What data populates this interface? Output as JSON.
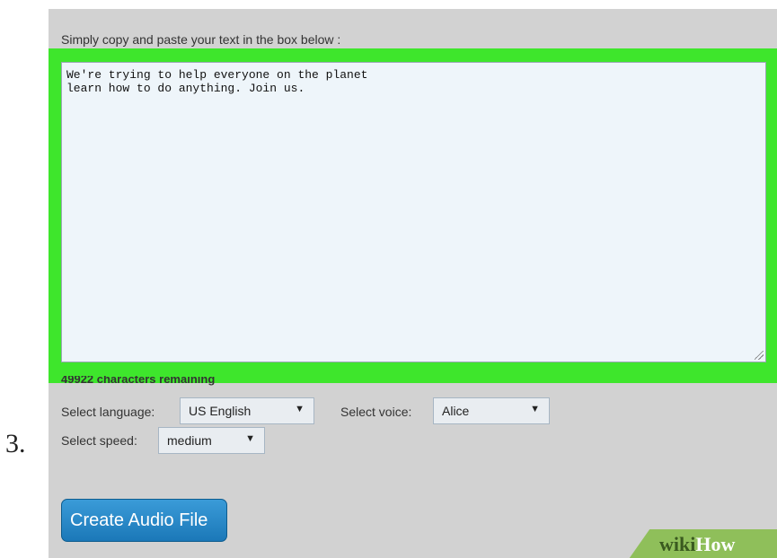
{
  "step_number": "3.",
  "instruction": "Simply copy and paste your text in the box below :",
  "textarea": {
    "value": "We're trying to help everyone on the planet\nlearn how to do anything. Join us."
  },
  "char_count": "49922 characters remaining",
  "language": {
    "label": "Select language:",
    "value": "US English"
  },
  "voice": {
    "label": "Select voice:",
    "value": "Alice"
  },
  "speed": {
    "label": "Select speed:",
    "value": "medium"
  },
  "create_button": "Create Audio File",
  "watermark": {
    "part1": "wiki",
    "part2": "How"
  },
  "colors": {
    "highlight": "#3ee62c",
    "button": "#1b78b8",
    "panel": "#d2d2d2"
  }
}
